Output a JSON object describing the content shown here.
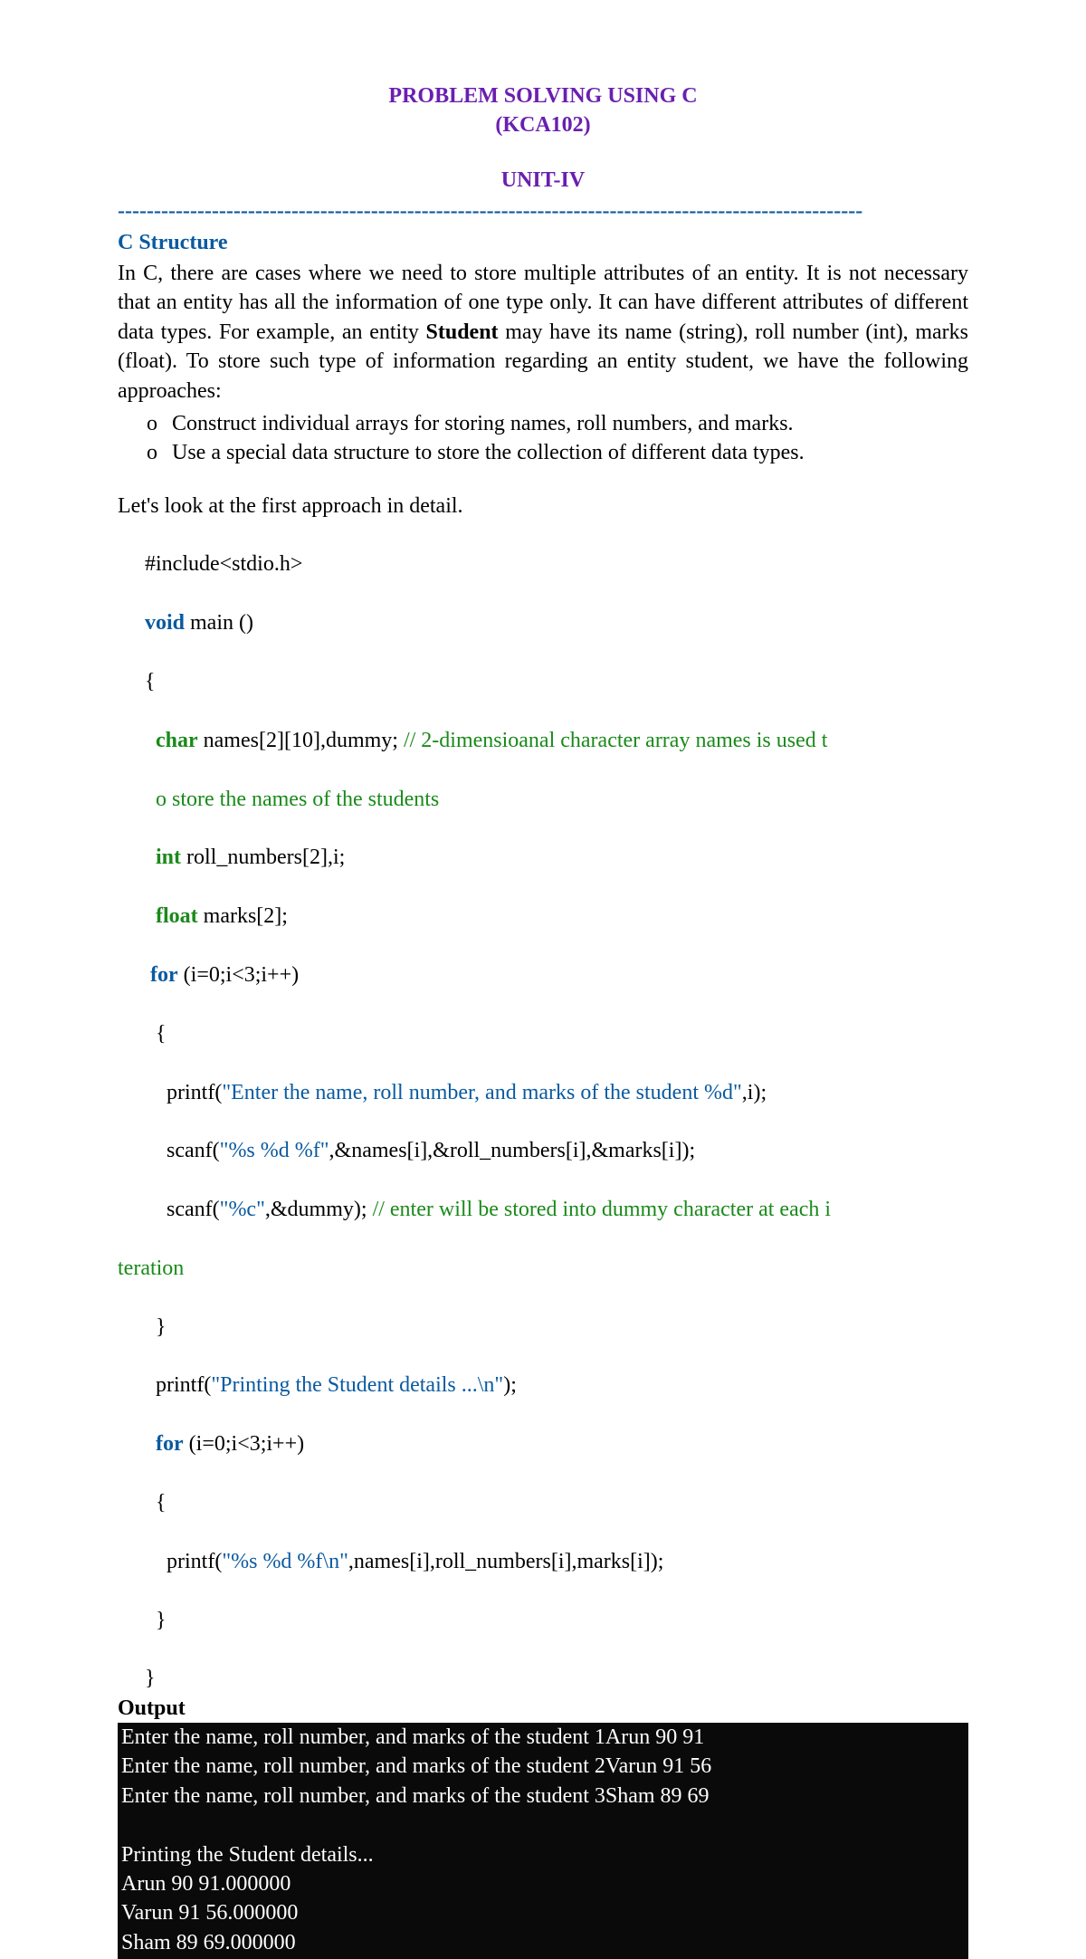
{
  "header": {
    "title": "PROBLEM SOLVING USING C",
    "course_code": "(KCA102)",
    "unit": "UNIT-IV",
    "divider": "-------------------------------------------------------------------------------------------------------"
  },
  "section": {
    "heading": "C Structure",
    "intro_part1": "In C, there are cases where we need to store multiple attributes of an entity. It is not necessary that an entity has all the information of one type only. It can have different attributes of different data types. For example, an entity ",
    "intro_bold": "Student",
    "intro_part2": " may have its name (string), roll number (int), marks (float). To store such type of information regarding an entity student, we have the following approaches:",
    "approaches": [
      "Construct individual arrays for storing names, roll numbers, and marks.",
      "Use a special data structure to store the collection of different data types."
    ],
    "lead_in": "Let's look at the first approach in detail."
  },
  "code": {
    "l1": "#include<stdio.h>",
    "l2_kw": "void",
    "l2_rest": " main ()",
    "l3": "{",
    "l4_kw": "char",
    "l4_rest": " names[2][10],dummy; ",
    "l4_cmt": "// 2-dimensioanal character array names is used t",
    "l5_cmt": "o store the names of the students",
    "l6_kw": "int",
    "l6_rest": " roll_numbers[2],i;",
    "l7_kw": "float",
    "l7_rest": " marks[2];",
    "l8_kw": "for",
    "l8_rest": " (i=0;i<3;i++)",
    "l9": "{",
    "l10_a": "printf(",
    "l10_str": "\"Enter the name, roll number, and marks of the student %d\"",
    "l10_b": ",i);",
    "l11_a": "scanf(",
    "l11_str": "\"%s %d %f\"",
    "l11_b": ",&names[i],&roll_numbers[i],&marks[i]);",
    "l12_a": "scanf(",
    "l12_str": "\"%c\"",
    "l12_b": ",&dummy); ",
    "l12_cmt": "// enter will be stored into dummy character at each i",
    "l13_cmt": "teration",
    "l14": "}",
    "l15_a": "printf(",
    "l15_str": "\"Printing the Student details ...\\n\"",
    "l15_b": ");",
    "l16_kw": "for",
    "l16_rest": " (i=0;i<3;i++)",
    "l17": "{",
    "l18_a": "printf(",
    "l18_str": "\"%s %d %f\\n\"",
    "l18_b": ",names[i],roll_numbers[i],marks[i]);",
    "l19": "}",
    "l20": "}"
  },
  "output": {
    "label": "Output",
    "lines": "Enter the name, roll number, and marks of the student 1Arun 90 91\nEnter the name, roll number, and marks of the student 2Varun 91 56\nEnter the name, roll number, and marks of the student 3Sham 89 69\n\nPrinting the Student details...\nArun 90 91.000000\nVarun 91 56.000000\nSham 89 69.000000"
  }
}
